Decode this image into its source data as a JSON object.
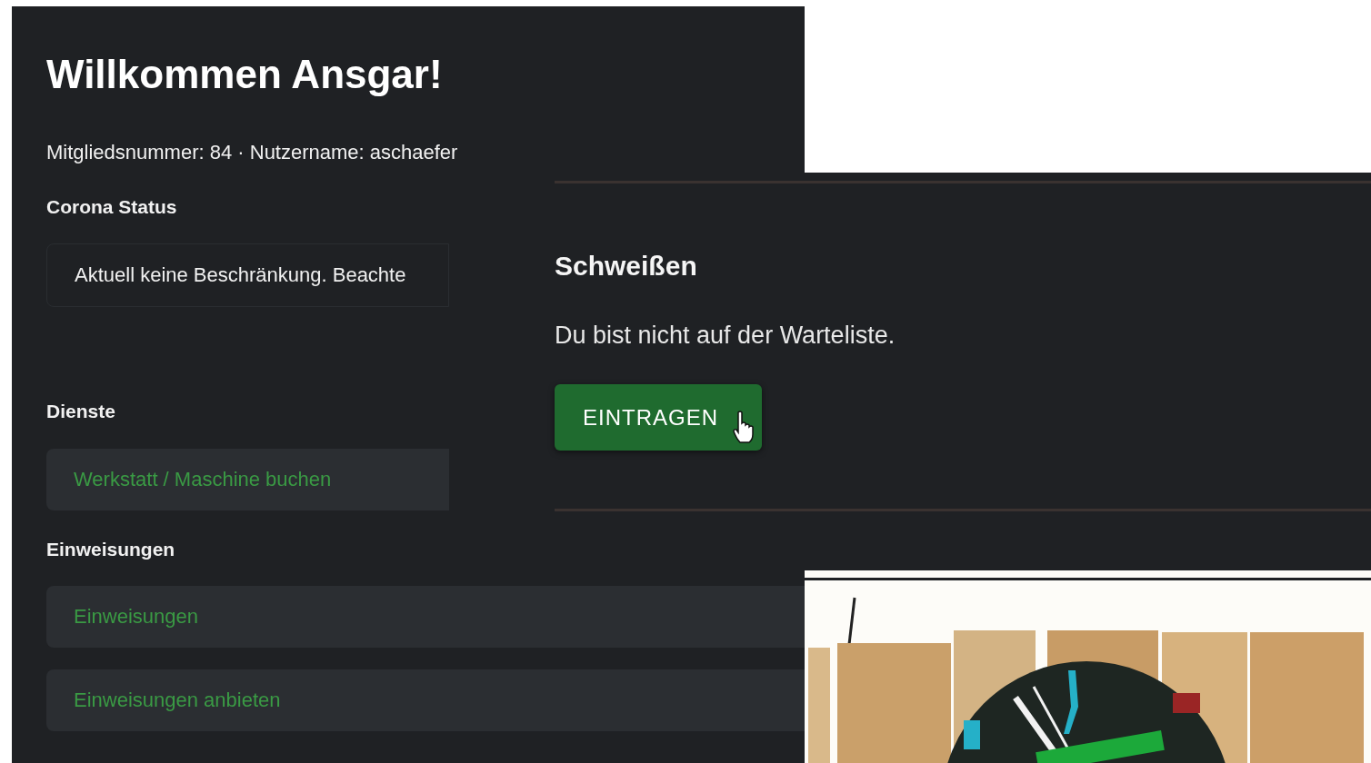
{
  "welcome": {
    "title": "Willkommen Ansgar!",
    "member_line": "Mitgliedsnummer: 84 · Nutzername: aschaefer"
  },
  "sections": [
    {
      "heading": "Corona Status",
      "items": [
        {
          "kind": "notice",
          "text": "Aktuell keine Beschränkung. Beachte"
        }
      ]
    },
    {
      "heading": "Dienste",
      "items": [
        {
          "kind": "link",
          "text": "Werkstatt / Maschine buchen"
        }
      ]
    },
    {
      "heading": "Einweisungen",
      "items": [
        {
          "kind": "link",
          "text": "Einweisungen"
        },
        {
          "kind": "link",
          "text": "Einweisungen anbieten"
        }
      ]
    }
  ],
  "waitlist": {
    "title": "Schweißen",
    "message": "Du bist nicht auf der Warteliste.",
    "button": "EINTRAGEN"
  }
}
